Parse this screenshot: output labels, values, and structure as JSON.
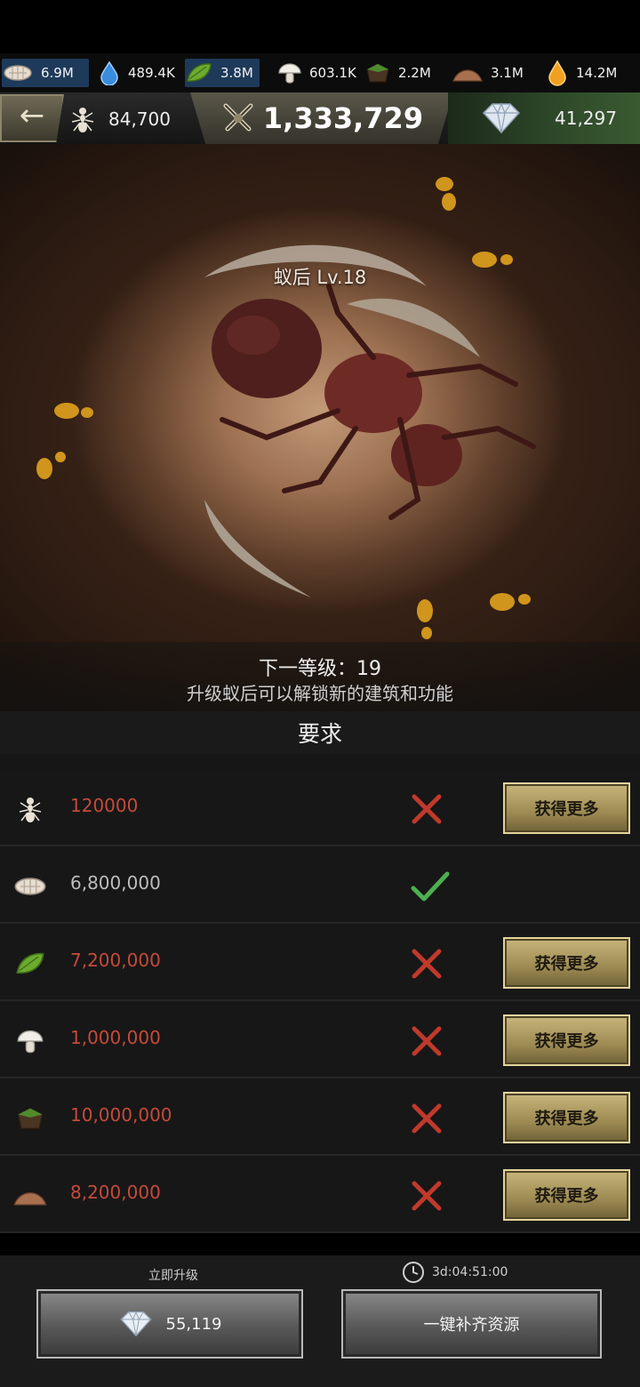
{
  "resources": [
    {
      "icon": "larva-icon",
      "value": "6.9M"
    },
    {
      "icon": "water-drop-icon",
      "value": "489.4K"
    },
    {
      "icon": "leaf-icon",
      "value": "3.8M"
    },
    {
      "icon": "mushroom-icon",
      "value": "603.1K"
    },
    {
      "icon": "soil-icon",
      "value": "2.2M"
    },
    {
      "icon": "sand-icon",
      "value": "3.1M"
    },
    {
      "icon": "honey-drop-icon",
      "value": "14.2M"
    }
  ],
  "header": {
    "back_icon": "←",
    "worker_count": "84,700",
    "power": "1,333,729",
    "diamonds": "41,297"
  },
  "scene": {
    "queen_label": "蚁后  Lv.18",
    "next_level_text": "下一等级：19",
    "unlock_desc": "升级蚁后可以解锁新的建筑和功能"
  },
  "requirements": {
    "title": "要求",
    "get_more_label": "获得更多",
    "rows": [
      {
        "icon": "ant-icon",
        "amount": "120000",
        "met": false
      },
      {
        "icon": "larva-icon",
        "amount": "6,800,000",
        "met": true
      },
      {
        "icon": "leaf-icon",
        "amount": "7,200,000",
        "met": false
      },
      {
        "icon": "mushroom-icon",
        "amount": "1,000,000",
        "met": false
      },
      {
        "icon": "soil-icon",
        "amount": "10,000,000",
        "met": false
      },
      {
        "icon": "sand-icon",
        "amount": "8,200,000",
        "met": false
      }
    ]
  },
  "bottom": {
    "instant_label": "立即升级",
    "instant_cost": "55,119",
    "timer": "3d:04:51:00",
    "fill_label": "一键补齐资源"
  },
  "colors": {
    "short_amount": "#c54a3a",
    "met_amount": "#bdbdbd",
    "cross": "#c0392b",
    "check": "#4caf50",
    "gold_button": "#b39e63"
  }
}
